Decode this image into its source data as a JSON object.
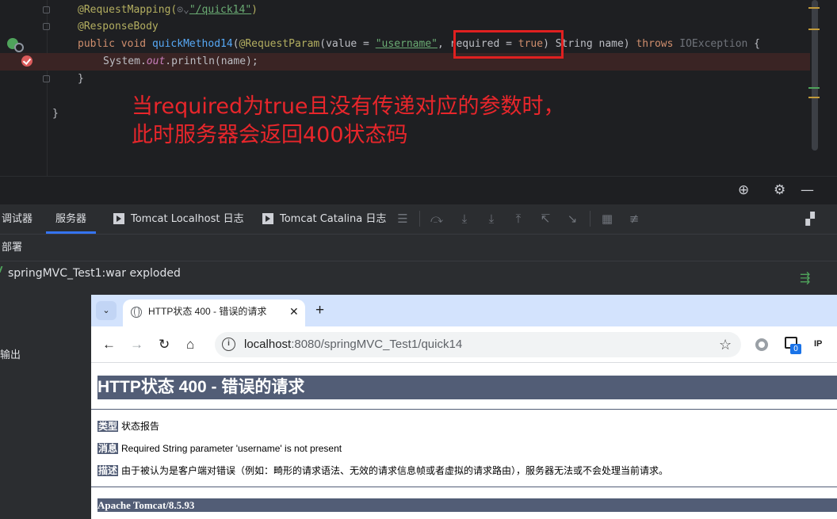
{
  "editor": {
    "lines": {
      "l1": {
        "ann": "@RequestMapping(",
        "mid": "⊙⌄",
        "str": "\"/quick14\"",
        "end": ")"
      },
      "l2": "@ResponseBody",
      "l3": {
        "kw1": "public",
        "kw2": "void",
        "fn": "quickMethod14",
        "p1": "(",
        "ann": "@RequestParam",
        "p2": "(value = ",
        "str": "\"username\"",
        "p3": ", required = ",
        "kw3": "true",
        "p4": ") String name) ",
        "kw4": "throws",
        "p5": " ",
        "exc": "IOException",
        "p6": " {"
      },
      "l4": {
        "a": "System.",
        "out": "out",
        "b": ".println(name);"
      },
      "l5": "}",
      "l6": "}"
    },
    "annotation_line1": "当required为true且没有传递对应的参数时，",
    "annotation_line2": "此时服务器会返回400状态码",
    "colors": {
      "note": "#e8262b",
      "box": "#e02020"
    }
  },
  "tool_window": {
    "tabs": [
      "调试器",
      "服务器",
      "Tomcat Localhost 日志",
      "Tomcat Catalina 日志"
    ],
    "active_tab": "服务器",
    "deploy_header": "部署",
    "deploy_item": "springMVC_Test1:war exploded",
    "output_label": "输出"
  },
  "browser": {
    "tab_title": "HTTP状态 400 - 错误的请求",
    "url_host": "localhost",
    "url_rest": ":8080/springMVC_Test1/quick14",
    "ext_badge": "0",
    "ext_label": "IP",
    "page": {
      "h1": "HTTP状态 400 - 错误的请求",
      "type_label": "类型",
      "type_value": "状态报告",
      "msg_label": "消息",
      "msg_value": "Required String parameter 'username' is not present",
      "desc_label": "描述",
      "desc_value": "由于被认为是客户端对错误（例如：畸形的请求语法、无效的请求信息帧或者虚拟的请求路由），服务器无法或不会处理当前请求。",
      "footer": "Apache Tomcat/8.5.93"
    }
  }
}
